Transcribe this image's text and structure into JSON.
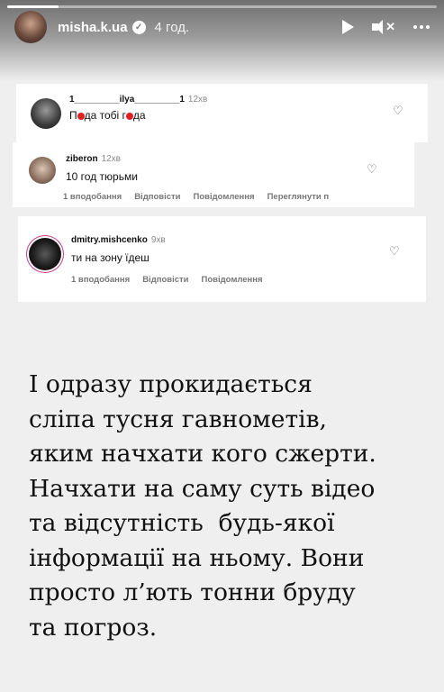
{
  "header": {
    "username": "misha.k.ua",
    "time": "4 год.",
    "progress": 0.12
  },
  "comments": [
    {
      "name": "1_________ilya_________1",
      "time": "12хв",
      "text_a": "П",
      "text_b": "да тобі г",
      "text_c": "да"
    },
    {
      "name": "ziberon",
      "time": "12хв",
      "text": "10 год тюрьми",
      "actions": [
        "1 вподобання",
        "Відповісти",
        "Повідомлення",
        "Переглянути п"
      ]
    },
    {
      "name": "dmitry.mishcenko",
      "time": "9хв",
      "text": "ти на зону їдеш",
      "actions": [
        "1 вподобання",
        "Відповісти",
        "Повідомлення"
      ]
    }
  ],
  "statement": [
    "І одразу прокидається",
    "сліпа тусня гавнометів,",
    "яким начхати кого сжерти.",
    "Начхати на саму суть відео",
    "та відсутність  будь-якої",
    "інформації на ньому. Вони",
    "просто л’ють тонни бруду",
    "та погроз."
  ]
}
